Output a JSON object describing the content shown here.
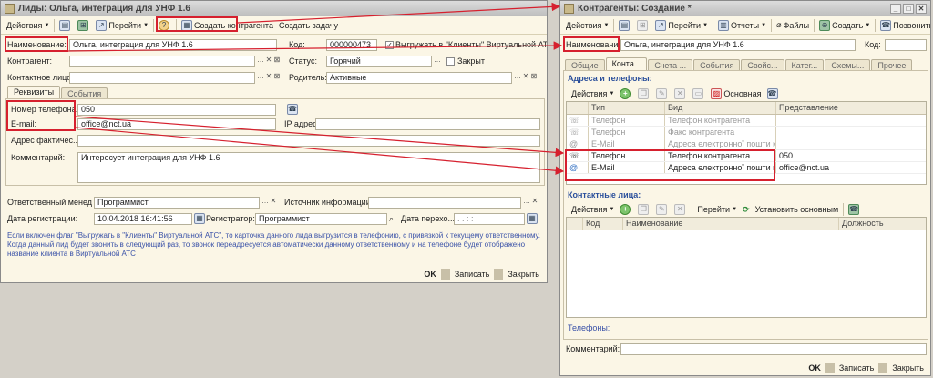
{
  "left": {
    "title": "Лиды: Ольга, интеграция для УНФ 1.6",
    "toolbar": {
      "actions": "Действия",
      "goto": "Перейти",
      "help": "?",
      "create_contractor": "Создать контрагента",
      "create_task": "Создать задачу"
    },
    "name_label": "Наименование:",
    "name_value": "Ольга, интеграция для УНФ 1.6",
    "code_label": "Код:",
    "code_value": "000000473",
    "export_label": "Выгружать в \"Клиенты\" Виртуальной АТС",
    "contractor_label": "Контрагент:",
    "status_label": "Статус:",
    "status_value": "Горячий",
    "closed_label": "Закрыт",
    "contact_label": "Контактное лицо:",
    "parent_label": "Родитель:",
    "parent_value": "Активные",
    "tabs": [
      "Реквизиты",
      "События"
    ],
    "phone_label": "Номер телефона:",
    "phone_value": "050",
    "email_label": "E-mail:",
    "email_value": "office@nct.ua",
    "ip_label": "IP адрес:",
    "address_label": "Адрес фактичес...",
    "comment_label": "Комментарий:",
    "comment_value": "Интересует интеграция для УНФ 1.6",
    "manager_label": "Ответственный менед...",
    "manager_value": "Программист",
    "source_label": "Источник информации:",
    "reg_date_label": "Дата регистрации:",
    "reg_date_value": "10.04.2018 16:41:56",
    "registrar_label": "Регистратор:",
    "registrar_value": "Программист",
    "transfer_label": "Дата перехо...",
    "transfer_value": ". .   :  :",
    "info_text": "Если включен флаг \"Выгружать в \"Клиенты\" Виртуальной АТС\", то карточка данного лида выгрузится в телефонию, с привязкой к текущему ответственному. Когда данный лид будет звонить в следующий раз, то звонок переадресуется автоматически данному ответственному и на телефоне будет отображено название клиента в Виртуальной АТС",
    "footer": {
      "ok": "OK",
      "save": "Записать",
      "close": "Закрыть"
    }
  },
  "right": {
    "title": "Контрагенты: Создание *",
    "toolbar": {
      "actions": "Действия",
      "goto": "Перейти",
      "reports": "Отчеты",
      "files": "Файлы",
      "create": "Создать",
      "call": "Позвонить"
    },
    "name_label": "Наименование:",
    "name_value": "Ольга, интеграция для УНФ 1.6",
    "code_label": "Код:",
    "tabs": [
      "Общие",
      "Конта...",
      "Счета ...",
      "События",
      "Свойс...",
      "Катег...",
      "Схемы...",
      "Прочее"
    ],
    "addr_section": "Адреса и телефоны:",
    "addr_toolbar": {
      "actions": "Действия",
      "main": "Основная"
    },
    "addr_headers": [
      "Тип",
      "Вид",
      "Представление"
    ],
    "addr_rows": [
      {
        "type": "Телефон",
        "kind": "Телефон контрагента",
        "value": "",
        "dim": true
      },
      {
        "type": "Телефон",
        "kind": "Факс контрагента",
        "value": "",
        "dim": true
      },
      {
        "type": "E-Mail",
        "kind": "Адреса електронної пошти ко...",
        "value": "",
        "dim": true
      },
      {
        "type": "Телефон",
        "kind": "Телефон контрагента",
        "value": "050",
        "dim": false
      },
      {
        "type": "E-Mail",
        "kind": "Адреса електронної пошти ко...",
        "value": "office@nct.ua",
        "dim": false
      }
    ],
    "contacts_section": "Контактные лица:",
    "contacts_toolbar": {
      "actions": "Действия",
      "goto": "Перейти",
      "set_main": "Установить основным"
    },
    "contacts_headers": [
      "Код",
      "Наименование",
      "Должность"
    ],
    "phones_label": "Телефоны:",
    "comment_label": "Комментарий:",
    "footer": {
      "ok": "OK",
      "save": "Записать",
      "close": "Закрыть"
    }
  },
  "colors": {
    "highlight": "#d6202e",
    "link": "#3a52a8",
    "section": "#2a4f9b"
  }
}
